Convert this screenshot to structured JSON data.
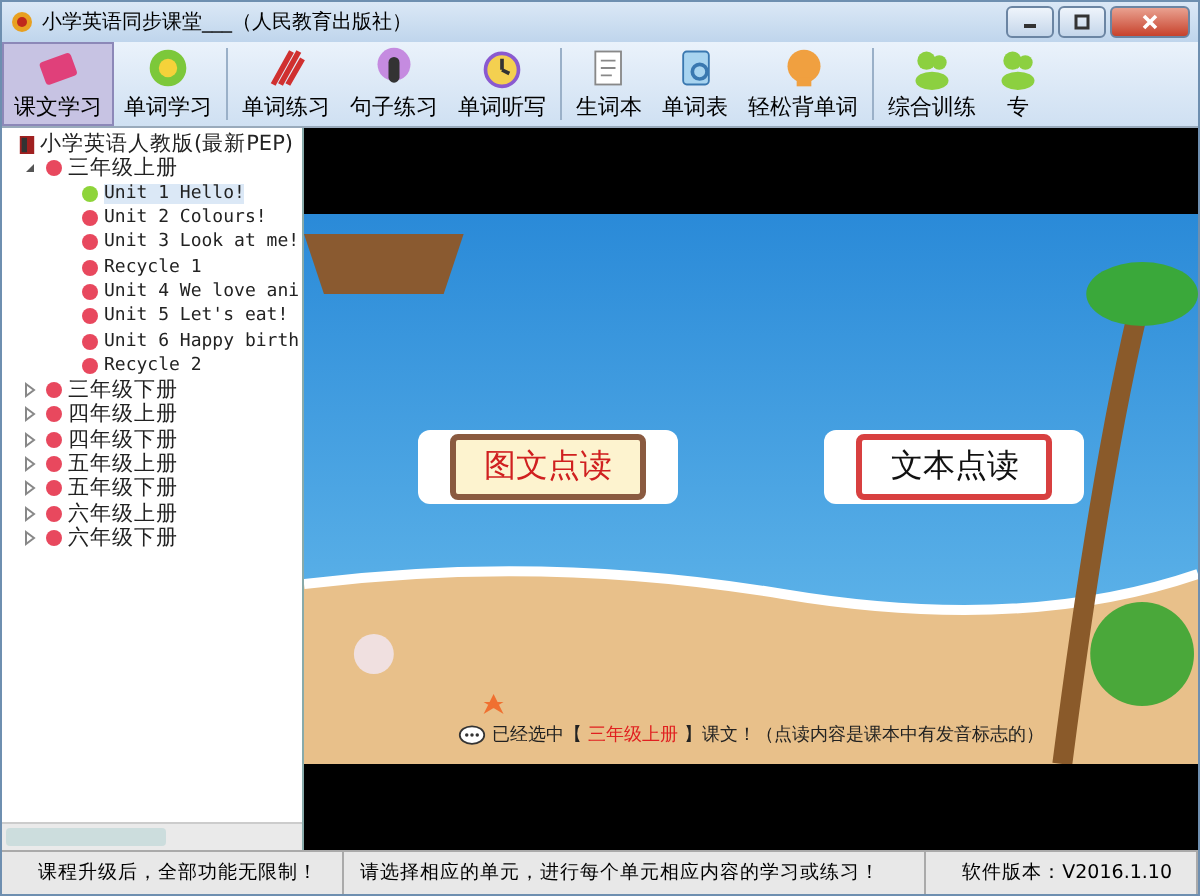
{
  "window": {
    "title": "小学英语同步课堂___（人民教育出版社）"
  },
  "toolbar": {
    "groups": [
      [
        {
          "label": "课文学习",
          "selected": true
        },
        {
          "label": "单词学习",
          "selected": false
        }
      ],
      [
        {
          "label": "单词练习",
          "selected": false
        },
        {
          "label": "句子练习",
          "selected": false
        },
        {
          "label": "单词听写",
          "selected": false
        }
      ],
      [
        {
          "label": "生词本",
          "selected": false
        },
        {
          "label": "单词表",
          "selected": false
        },
        {
          "label": "轻松背单词",
          "selected": false
        }
      ],
      [
        {
          "label": "综合训练",
          "selected": false
        },
        {
          "label": "专",
          "selected": false
        }
      ]
    ]
  },
  "tree": {
    "label": "小学英语人教版(最新PEP)",
    "expanded": true,
    "children": [
      {
        "label": "三年级上册",
        "expanded": true,
        "children": [
          {
            "label": "Unit 1 Hello!",
            "selected": true
          },
          {
            "label": "Unit 2 Colours!",
            "selected": false
          },
          {
            "label": "Unit 3 Look at me!",
            "selected": false
          },
          {
            "label": "Recycle 1",
            "selected": false
          },
          {
            "label": "Unit 4 We love ani",
            "selected": false
          },
          {
            "label": "Unit 5 Let's eat!",
            "selected": false
          },
          {
            "label": "Unit 6 Happy birth",
            "selected": false
          },
          {
            "label": "Recycle 2",
            "selected": false
          }
        ]
      },
      {
        "label": "三年级下册",
        "expanded": false
      },
      {
        "label": "四年级上册",
        "expanded": false
      },
      {
        "label": "四年级下册",
        "expanded": false
      },
      {
        "label": "五年级上册",
        "expanded": false
      },
      {
        "label": "五年级下册",
        "expanded": false
      },
      {
        "label": "六年级上册",
        "expanded": false
      },
      {
        "label": "六年级下册",
        "expanded": false
      }
    ]
  },
  "scene": {
    "buttons": [
      "图文点读",
      "文本点读"
    ],
    "hint": {
      "prefix": "已经选中【",
      "selection": "三年级上册",
      "suffix": "】课文！（点读内容是课本中有发音标志的）"
    }
  },
  "status_bar": [
    "课程升级后，全部功能无限制！",
    "请选择相应的单元，进行每个单元相应内容的学习或练习！",
    "软件版本：V2016.1.10"
  ]
}
